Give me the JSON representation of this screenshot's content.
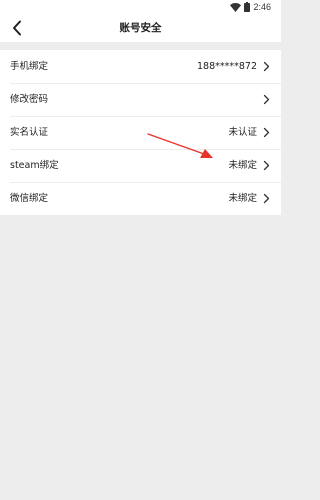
{
  "status_bar": {
    "time": "2:46",
    "icons": [
      "wifi-icon",
      "battery-icon"
    ]
  },
  "header": {
    "title": "账号安全",
    "back_icon": "chevron-left-icon"
  },
  "settings": {
    "items": [
      {
        "label": "手机绑定",
        "value": "188*****872"
      },
      {
        "label": "修改密码",
        "value": ""
      },
      {
        "label": "实名认证",
        "value": "未认证"
      },
      {
        "label": "steam绑定",
        "value": "未绑定"
      },
      {
        "label": "微信绑定",
        "value": "未绑定"
      }
    ]
  },
  "colors": {
    "background": "#ededed",
    "surface": "#ffffff",
    "text": "#222222",
    "annotation_arrow": "#e8332a"
  }
}
